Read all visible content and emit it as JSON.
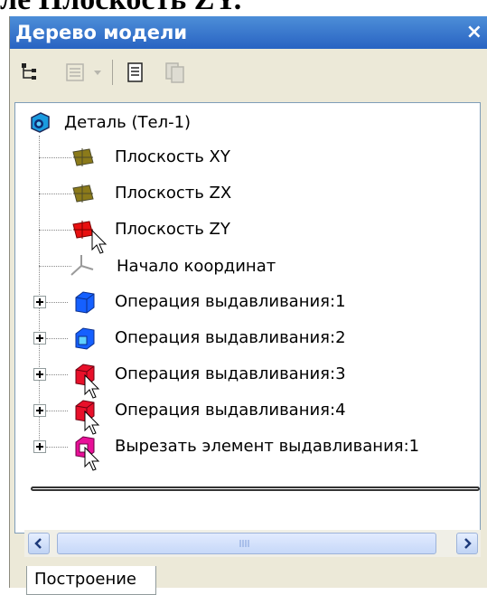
{
  "heading_fragment": "ле Плоскость ZY.",
  "window": {
    "title": "Дерево модели",
    "close_symbol": "×"
  },
  "toolbar": {
    "buttons": [
      {
        "icon": "tree-structure-icon",
        "enabled": true
      },
      {
        "icon": "list-filter-icon",
        "enabled": false
      },
      {
        "icon": "dropdown-arrow-icon",
        "enabled": false
      },
      {
        "icon": "document-icon",
        "enabled": true
      },
      {
        "icon": "document-copy-icon",
        "enabled": false
      }
    ]
  },
  "tree": {
    "root": {
      "label": "Деталь (Тел-1)",
      "icon": "part-body-icon"
    },
    "items": [
      {
        "label": "Плоскость XY",
        "icon": "plane-icon",
        "color": "#8b7a1a",
        "expandable": false
      },
      {
        "label": "Плоскость ZX",
        "icon": "plane-icon",
        "color": "#8b7a1a",
        "expandable": false
      },
      {
        "label": "Плоскость ZY",
        "icon": "plane-icon",
        "color": "#e81010",
        "expandable": false
      },
      {
        "label": "Начало координат",
        "icon": "origin-axes-icon",
        "color": "#9a9a9a",
        "expandable": false
      },
      {
        "label": "Операция выдавливания:1",
        "icon": "extrude-cube-icon",
        "color": "#1560ff",
        "expandable": true
      },
      {
        "label": "Операция выдавливания:2",
        "icon": "extrude-cube-icon",
        "color": "#1560ff",
        "expandable": true
      },
      {
        "label": "Операция выдавливания:3",
        "icon": "extrude-cube-icon",
        "color": "#e8102a",
        "expandable": true
      },
      {
        "label": "Операция выдавливания:4",
        "icon": "extrude-cube-icon",
        "color": "#e8102a",
        "expandable": true
      },
      {
        "label": "Вырезать элемент выдавливания:1",
        "icon": "cut-extrude-icon",
        "color": "#e81098",
        "expandable": true
      }
    ]
  },
  "scrollbar": {
    "left_arrow": "<",
    "right_arrow": ">"
  },
  "tabs": [
    {
      "label": "Построение",
      "active": true
    }
  ]
}
